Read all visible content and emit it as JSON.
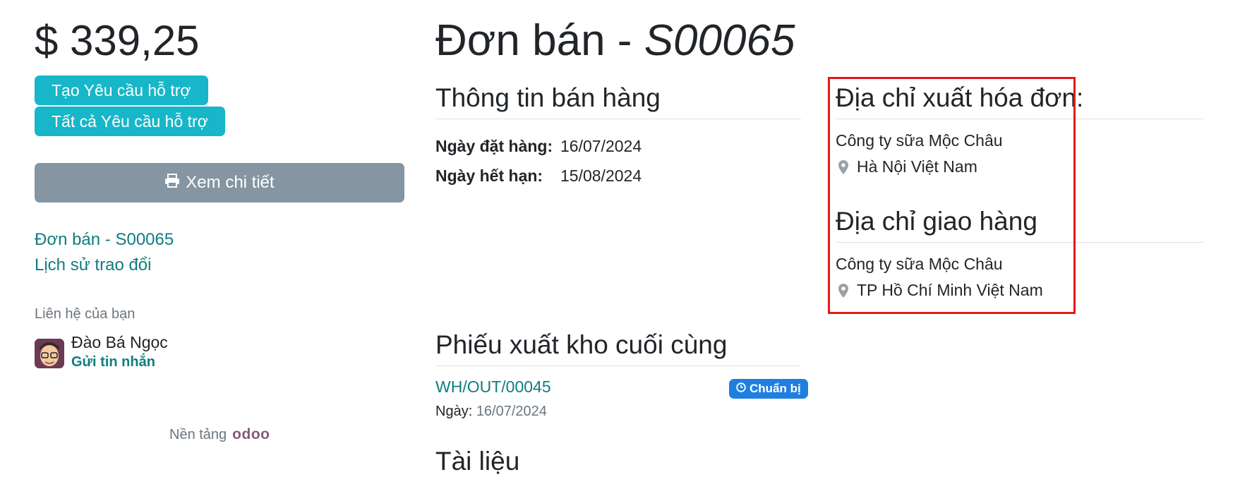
{
  "sidebar": {
    "amount": "$ 339,25",
    "create_ticket": "Tạo Yêu cầu hỗ trợ",
    "all_tickets": "Tất cả Yêu cầu hỗ trợ",
    "view_details": "Xem chi tiết",
    "nav_order": "Đơn bán - S00065",
    "nav_history": "Lịch sử trao đổi",
    "contact_label": "Liên hệ của bạn",
    "contact_name": "Đào Bá Ngọc",
    "send_message": "Gửi tin nhắn",
    "powered_by": "Nền tảng",
    "brand": "odoo"
  },
  "main": {
    "title_prefix": "Đơn bán - ",
    "title_ref": "S00065",
    "sales_info": {
      "heading": "Thông tin bán hàng",
      "order_date_label": "Ngày đặt hàng:",
      "order_date": "16/07/2024",
      "expiry_label": "Ngày hết hạn:",
      "expiry_date": "15/08/2024"
    },
    "billing": {
      "heading": "Địa chỉ xuất hóa đơn:",
      "company": "Công ty sữa Mộc Châu",
      "location": "Hà Nội Việt Nam"
    },
    "shipping": {
      "heading": "Địa chỉ giao hàng",
      "company": "Công ty sữa Mộc Châu",
      "location": "TP Hồ Chí Minh Việt Nam"
    },
    "delivery": {
      "heading": "Phiếu xuất kho cuối cùng",
      "ref": "WH/OUT/00045",
      "status": "Chuẩn bị",
      "date_label": "Ngày:",
      "date": "16/07/2024"
    },
    "documents": {
      "heading": "Tài liệu"
    }
  },
  "colors": {
    "accent": "#17b6c9",
    "link": "#0f7d80",
    "view_button": "#8595a2",
    "badge": "#1f7fe0",
    "highlight_box": "#e11b1b"
  }
}
